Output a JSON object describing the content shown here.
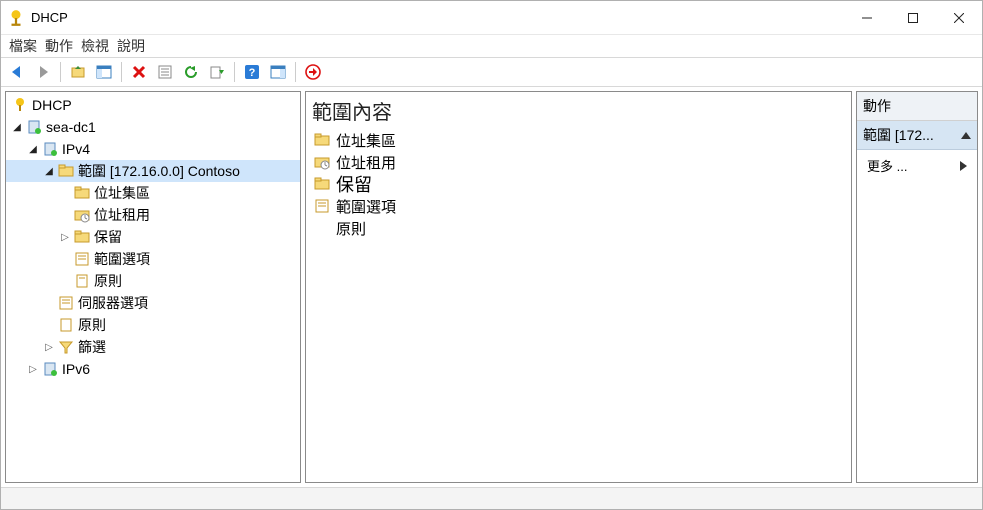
{
  "window": {
    "title": "DHCP"
  },
  "menus": {
    "file": "檔案",
    "action": "動作",
    "view": "檢視",
    "help": "說明"
  },
  "tree": {
    "root": "DHCP",
    "server": "sea-dc1",
    "ipv4": "IPv4",
    "scope": "範圍 [172.16.0.0] Contoso",
    "pool": "位址集區",
    "leases": "位址租用",
    "reservations": "保留",
    "scope_options": "範圍選項",
    "policies": "原則",
    "server_options": "伺服器選項",
    "server_policies": "原則",
    "filters": "篩選",
    "ipv6": "IPv6"
  },
  "content": {
    "title": "範圍內容",
    "pool": "位址集區",
    "leases": "位址租用",
    "reservations": "保留",
    "scope_options": "範圍選項",
    "policies": "原則"
  },
  "actions": {
    "header": "動作",
    "scope_short": "範圍 [172...",
    "more": "更多 ..."
  }
}
